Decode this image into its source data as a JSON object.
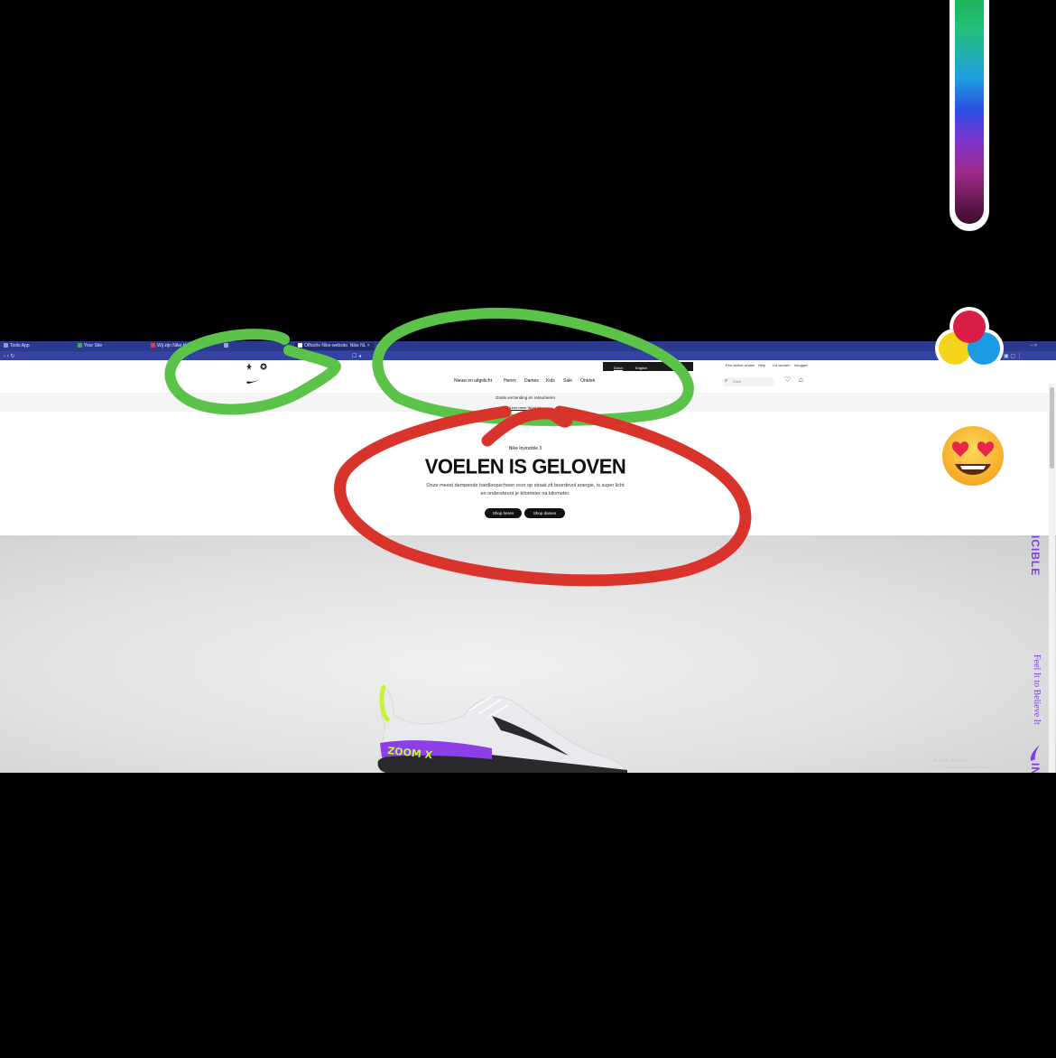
{
  "browser": {
    "tabs": [
      {
        "label": "Tools App",
        "favicon_color": "#8e9bd6"
      },
      {
        "label": "Your Site",
        "favicon_color": "#46a35a"
      },
      {
        "label": "Wij zijn Nike Heel",
        "favicon_color": "#e04040"
      },
      {
        "label": "",
        "favicon_color": "#9aa4e0"
      },
      {
        "label": "Officiële Nike-website. Nike NL",
        "favicon_color": "#111111"
      }
    ]
  },
  "site": {
    "top_links": [
      "Een winkel vinden",
      "Help",
      "Lid worden",
      "Inloggen"
    ],
    "language_options": [
      "Dutch",
      "English"
    ],
    "nav": [
      "Nieuw en uitgelicht",
      "Heren",
      "Dames",
      "Kids",
      "Sale",
      "Ontdek"
    ],
    "search_placeholder": "Zoek",
    "promo_text": "Gratis verzending en retourneren",
    "promo_links": "Lees meer   Word lid"
  },
  "hero": {
    "eyebrow": "Nike Invincible 3",
    "title": "VOELEN IS GELOVEN",
    "subtitle": "Onze meest dempende hardloopschoen voor op straat zit boordevol energie, is super licht en ondersteunt je kilometer na kilometer.",
    "buttons": [
      "Shop heren",
      "Shop dames"
    ]
  },
  "side_text": {
    "word": "INVINCIBLE",
    "tagline": "Feel It to Believe It",
    "top_fragment": "ICIBLE"
  },
  "watermark": {
    "line1": "Activate Windows",
    "line2": "Go to Settings to activate Windows."
  },
  "colors": {
    "green_annotation": "#5cc34a",
    "red_annotation": "#d9342b",
    "nike_purple": "#7b3fe4",
    "tab_bar": "#2b3a8f"
  }
}
